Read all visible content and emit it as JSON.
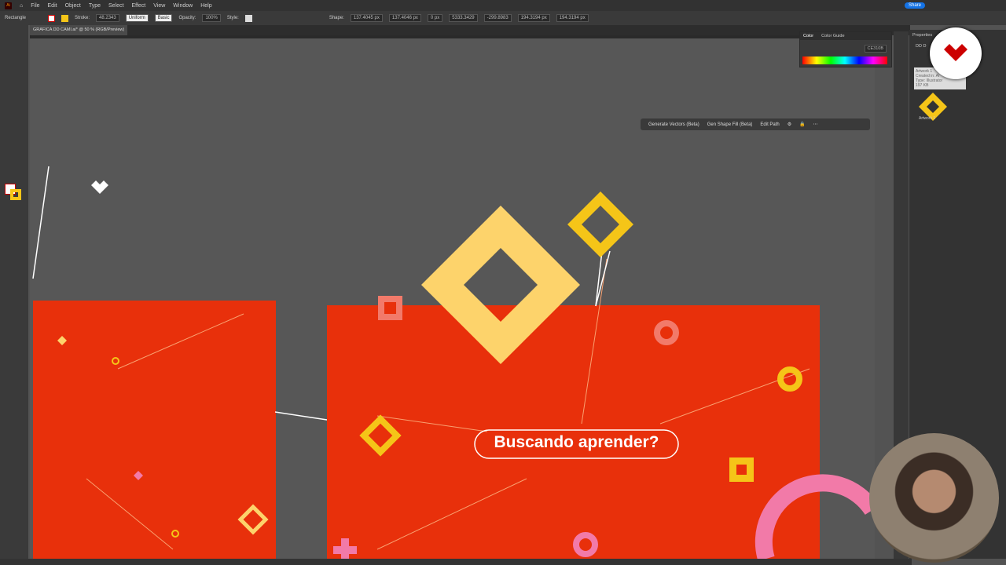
{
  "menu": [
    "File",
    "Edit",
    "Object",
    "Type",
    "Select",
    "Effect",
    "View",
    "Window",
    "Help"
  ],
  "control": {
    "object_type": "Rectangle",
    "stroke_label": "Stroke:",
    "stroke_value": "48.2343",
    "profile": "Uniform",
    "brush": "Basic",
    "opacity_label": "Opacity:",
    "opacity": "100%",
    "style_label": "Style:",
    "shape_label": "Shape:",
    "shape_w": "137.4045 px",
    "shape_h": "137.4046 px",
    "corner": "0 px",
    "x": "5333.3429",
    "y": "-299.8983",
    "w": "194.3194 px",
    "h": "194.3194 px"
  },
  "share_label": "Share",
  "document_tab": "GRAFICA DD CAMI.ai* @ 50 % (RGB/Preview)",
  "color_panel": {
    "tabs": [
      "Color",
      "Color Guide"
    ],
    "hex": "CE310B"
  },
  "context_bar": [
    "Generate Vectors (Beta)",
    "Gen Shape Fill (Beta)",
    "Edit Path"
  ],
  "properties": {
    "title": "Properties",
    "back": "DD D",
    "tooltip": [
      "Artwork 1",
      "Created in: Ai",
      "Type: Illustrator",
      "197 KB"
    ],
    "item_label": "Artwork 1"
  },
  "artwork": {
    "headline": "Buscando aprender?",
    "red": "#e8300b",
    "yellow": "#f5c518",
    "pale_yellow": "#fdd36b",
    "pink": "#f27aa8"
  }
}
